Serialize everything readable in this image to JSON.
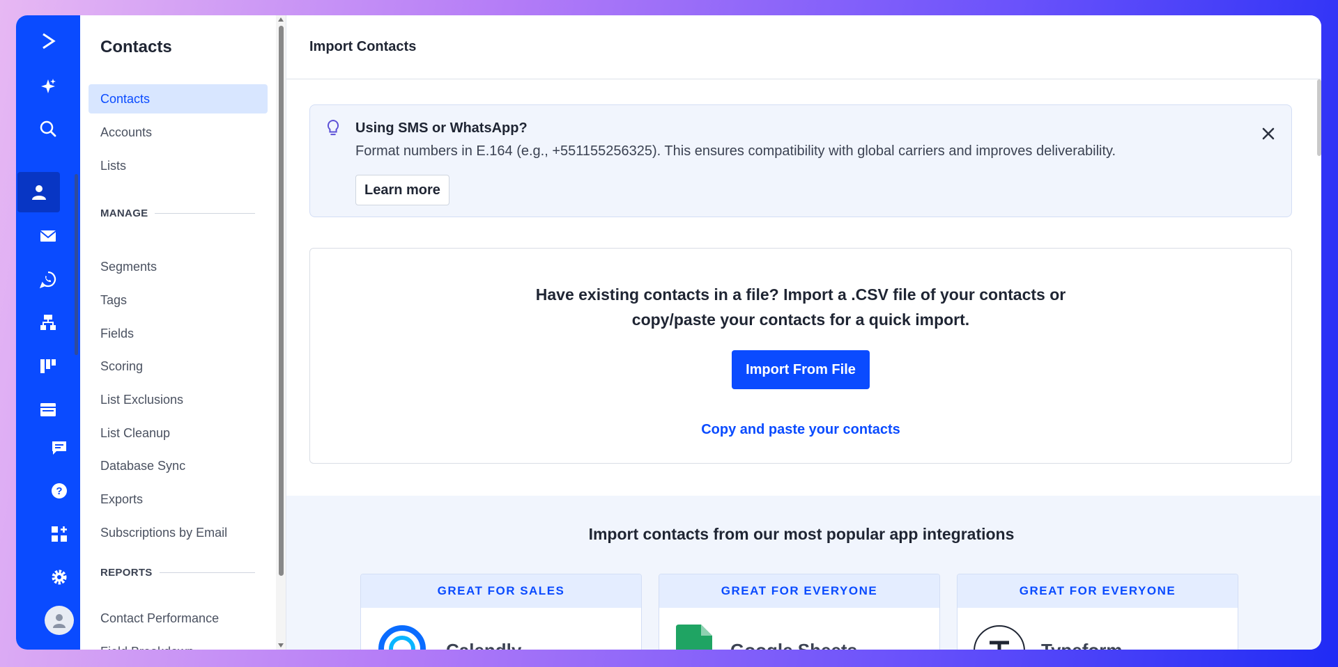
{
  "colors": {
    "brand": "#0a4bff",
    "rail_active": "#0836c4",
    "banner_bg": "#f1f5fd"
  },
  "rail": {
    "items": [
      {
        "icon": "logo-chevron-icon"
      },
      {
        "icon": "sparkle-ai-icon"
      },
      {
        "icon": "search-icon"
      },
      {
        "icon": "contacts-person-icon",
        "active": true
      },
      {
        "icon": "email-envelope-icon"
      },
      {
        "icon": "whatsapp-icon"
      },
      {
        "icon": "automations-sitemap-icon"
      },
      {
        "icon": "deals-pipeline-icon"
      },
      {
        "icon": "website-browser-icon"
      },
      {
        "icon": "conversations-chat-icon"
      },
      {
        "icon": "help-question-icon"
      },
      {
        "icon": "apps-grid-plus-icon"
      },
      {
        "icon": "settings-gear-icon"
      },
      {
        "icon": "user-avatar-icon"
      }
    ]
  },
  "sidebar": {
    "title": "Contacts",
    "top_items": [
      {
        "label": "Contacts",
        "active": true
      },
      {
        "label": "Accounts"
      },
      {
        "label": "Lists"
      }
    ],
    "manage_heading": "MANAGE",
    "manage_items": [
      {
        "label": "Segments"
      },
      {
        "label": "Tags"
      },
      {
        "label": "Fields"
      },
      {
        "label": "Scoring"
      },
      {
        "label": "List Exclusions"
      },
      {
        "label": "List Cleanup"
      },
      {
        "label": "Database Sync"
      },
      {
        "label": "Exports"
      },
      {
        "label": "Subscriptions by Email"
      }
    ],
    "reports_heading": "REPORTS",
    "reports_items": [
      {
        "label": "Contact Performance"
      },
      {
        "label": "Field Breakdown"
      }
    ]
  },
  "main": {
    "page_title": "Import Contacts",
    "banner": {
      "title": "Using SMS or WhatsApp?",
      "text": "Format numbers in E.164 (e.g., +551155256325). This ensures compatibility with global carriers and improves deliverability.",
      "button": "Learn more"
    },
    "import": {
      "heading_line1": "Have existing contacts in a file? Import a .CSV file of your contacts or",
      "heading_line2": "copy/paste your contacts for a quick import.",
      "button": "Import From File",
      "link": "Copy and paste your contacts"
    },
    "integrations": {
      "title": "Import contacts from our most popular app integrations",
      "cards": [
        {
          "tag": "GREAT FOR SALES",
          "name": "Calendly",
          "icon": "calendly-logo-icon"
        },
        {
          "tag": "GREAT FOR EVERYONE",
          "name": "Google Sheets",
          "icon": "google-sheets-logo-icon"
        },
        {
          "tag": "GREAT FOR EVERYONE",
          "name": "Typeform",
          "icon": "typeform-logo-icon"
        }
      ]
    }
  }
}
